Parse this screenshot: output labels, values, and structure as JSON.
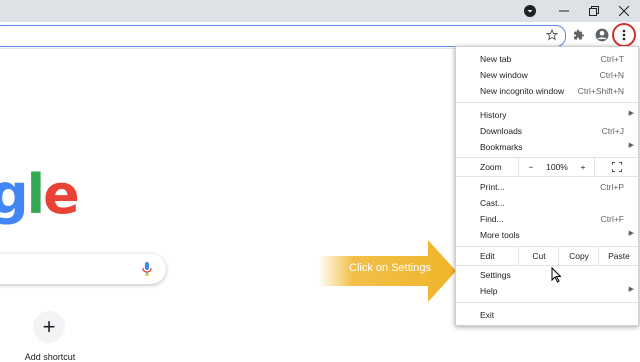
{
  "browser": {
    "colors": {
      "accent": "#1a73e8",
      "highlight_ring": "#d32f2f"
    },
    "icons": [
      "profile-dropdown-icon",
      "minimize-icon",
      "restore-icon",
      "close-icon",
      "star-icon",
      "extensions-icon",
      "account-icon",
      "more-vert-icon"
    ]
  },
  "page": {
    "logo_text": "gle",
    "shortcut": {
      "icon": "+",
      "label": "Add shortcut"
    }
  },
  "callout": {
    "text": "Click on Settings",
    "color": "#f0b429"
  },
  "menu": {
    "new_tab": {
      "label": "New tab",
      "shortcut": "Ctrl+T"
    },
    "new_window": {
      "label": "New window",
      "shortcut": "Ctrl+N"
    },
    "new_incognito": {
      "label": "New incognito window",
      "shortcut": "Ctrl+Shift+N"
    },
    "history": {
      "label": "History"
    },
    "downloads": {
      "label": "Downloads",
      "shortcut": "Ctrl+J"
    },
    "bookmarks": {
      "label": "Bookmarks"
    },
    "zoom": {
      "label": "Zoom",
      "minus": "−",
      "value": "100%",
      "plus": "+"
    },
    "print": {
      "label": "Print...",
      "shortcut": "Ctrl+P"
    },
    "cast": {
      "label": "Cast..."
    },
    "find": {
      "label": "Find...",
      "shortcut": "Ctrl+F"
    },
    "more_tools": {
      "label": "More tools"
    },
    "edit": {
      "label": "Edit",
      "cut": "Cut",
      "copy": "Copy",
      "paste": "Paste"
    },
    "settings": {
      "label": "Settings"
    },
    "help": {
      "label": "Help"
    },
    "exit": {
      "label": "Exit"
    }
  }
}
